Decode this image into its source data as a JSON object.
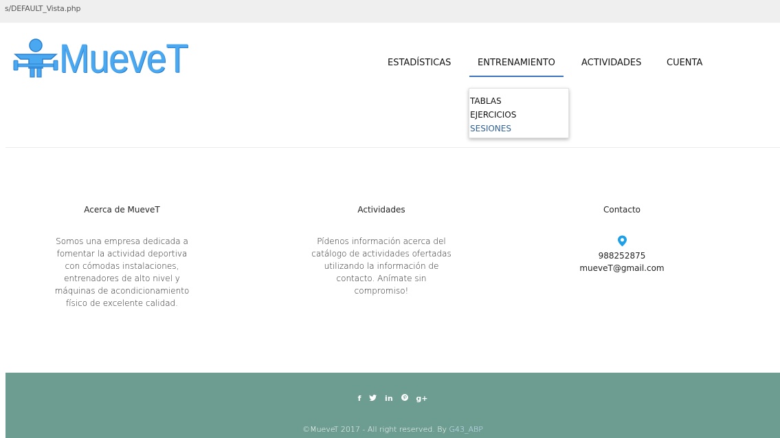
{
  "browser": {
    "url": "s/DEFAULT_Vista.php"
  },
  "logo": {
    "text": "MueveT"
  },
  "nav": {
    "items": [
      "ESTADÍSTICAS",
      "ENTRENAMIENTO",
      "ACTIVIDADES",
      "CUENTA"
    ],
    "active": "ENTRENAMIENTO"
  },
  "dropdown": {
    "items": [
      "TABLAS",
      "EJERCICIOS",
      "SESIONES"
    ],
    "highlighted": "SESIONES"
  },
  "about": {
    "title": "Acerca de MueveT",
    "text": "Somos una empresa dedicada a fomentar la actividad deportiva con cómodas instalaciones, entrenadores de alto nivel y máquinas de acondicionamiento físico de excelente calidad."
  },
  "activities": {
    "title": "Actividades",
    "text": "Pídenos información acerca del catálogo de actividades ofertadas utilizando la información de contacto. Anímate sin compromiso!"
  },
  "contact": {
    "title": "Contacto",
    "phone": "988252875",
    "email": "mueveT@gmail.com",
    "icon": "location-pin-icon"
  },
  "footer": {
    "social": [
      "f",
      "twitter-icon",
      "in",
      "pinterest-icon",
      "g+"
    ],
    "copyright_text": "©MueveT 2017 - All right reserved. By ",
    "copyright_link": "G43_ABP",
    "background": "#6d9d90"
  },
  "colors": {
    "brand_blue": "#4aa8f0",
    "nav_underline": "#3a72c0",
    "highlight": "#2f5f93",
    "pin": "#1ea0e8"
  }
}
